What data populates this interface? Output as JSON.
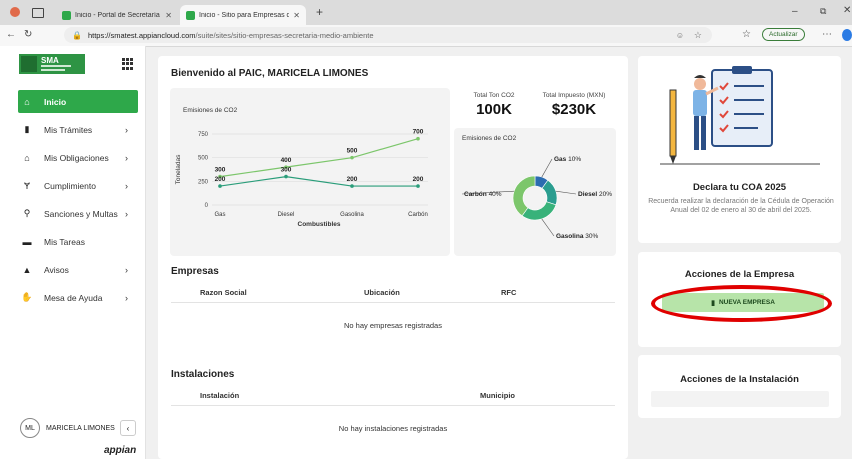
{
  "browser": {
    "tabs": [
      {
        "title": "Inicio - Portal de Secretaría de Me"
      },
      {
        "title": "Inicio - Sitio para Empresas de la"
      }
    ],
    "url_host": "https://smatest.appiancloud.com",
    "url_path": "/suite/sites/sitio-empresas-secretaria-medio-ambiente",
    "update_label": "Actualizar"
  },
  "sidebar": {
    "logo_text": "SMA",
    "items": [
      {
        "label": "Inicio",
        "icon": "home-icon"
      },
      {
        "label": "Mis Trámites",
        "icon": "document-icon"
      },
      {
        "label": "Mis Obligaciones",
        "icon": "institution-icon"
      },
      {
        "label": "Cumplimiento",
        "icon": "fork-icon"
      },
      {
        "label": "Sanciones y Multas",
        "icon": "search-person-icon"
      },
      {
        "label": "Mis Tareas",
        "icon": "briefcase-icon"
      },
      {
        "label": "Avisos",
        "icon": "warning-icon"
      },
      {
        "label": "Mesa de Ayuda",
        "icon": "handshake-icon"
      }
    ],
    "user_initials": "ML",
    "user_name": "MARICELA LIMONES",
    "brand": "appian"
  },
  "main": {
    "welcome": "Bienvenido al PAIC, MARICELA LIMONES",
    "kpis": [
      {
        "label": "Total Ton CO2",
        "value": "100K"
      },
      {
        "label": "Total Impuesto (MXN)",
        "value": "$230K"
      }
    ],
    "empresas": {
      "title": "Empresas",
      "columns": [
        "Razon Social",
        "Ubicación",
        "RFC"
      ],
      "empty": "No hay empresas registradas"
    },
    "instalaciones": {
      "title": "Instalaciones",
      "columns": [
        "Instalación",
        "Municipio"
      ],
      "empty": "No hay instalaciones registradas"
    }
  },
  "right": {
    "coa_title": "Declara tu COA 2025",
    "coa_desc": "Recuerda realizar la declaración de la Cédula de Operación Anual del 02 de enero al 30 de abril del 2025.",
    "empresa_title": "Acciones de la Empresa",
    "new_company": "NUEVA EMPRESA",
    "instalacion_title": "Acciones de la Instalación"
  },
  "chart_data": [
    {
      "type": "line",
      "title": "Emisiones de CO2",
      "xlabel": "Combustibles",
      "ylabel": "Toneladas",
      "categories": [
        "Gas",
        "Diesel",
        "Gasolina",
        "Carbón"
      ],
      "series": [
        {
          "values": [
            300,
            400,
            500,
            700
          ],
          "color": "#7cc66b"
        },
        {
          "values": [
            200,
            300,
            200,
            200
          ],
          "color": "#2a9d7a"
        }
      ],
      "ylim": [
        0,
        750
      ],
      "yticks": [
        0,
        250,
        500,
        750
      ],
      "grid": true
    },
    {
      "type": "pie",
      "title": "Emisiones de CO2",
      "slices": [
        {
          "label": "Gas",
          "value": 10,
          "color": "#2b6cb0"
        },
        {
          "label": "Diesel",
          "value": 20,
          "color": "#2a9d8f"
        },
        {
          "label": "Gasolina",
          "value": 30,
          "color": "#38b27a"
        },
        {
          "label": "Carbón",
          "value": 40,
          "color": "#7cc66b"
        }
      ]
    }
  ]
}
